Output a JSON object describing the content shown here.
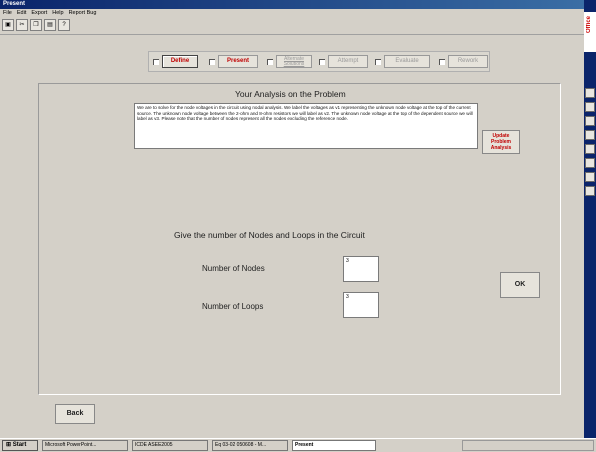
{
  "window": {
    "title": "Present"
  },
  "menu": [
    "File",
    "Edit",
    "Export",
    "Help",
    "Report Bug"
  ],
  "toolbar": [
    {
      "name": "save-icon",
      "glyph": "▣"
    },
    {
      "name": "cut-icon",
      "glyph": "✂"
    },
    {
      "name": "copy-icon",
      "glyph": "❐"
    },
    {
      "name": "paste-icon",
      "glyph": "▤"
    },
    {
      "name": "help-icon",
      "glyph": "?"
    }
  ],
  "steps": [
    {
      "label": "Define",
      "checked": true,
      "enabled": true
    },
    {
      "label": "Present",
      "checked": false,
      "enabled": true
    },
    {
      "label": "Alternate Solutions",
      "checked": false,
      "enabled": false
    },
    {
      "label": "Attempt",
      "checked": false,
      "enabled": false
    },
    {
      "label": "Evaluate",
      "checked": false,
      "enabled": false
    },
    {
      "label": "Rework",
      "checked": false,
      "enabled": false
    }
  ],
  "analysis": {
    "title": "Your Analysis on the Problem",
    "text": "We are to solve for the node voltages in the circuit using nodal analysis.  We label the voltages as v1 representing the unknown node voltage at the top of the current source.  The unknown node voltage between the 2-ohm and 8-ohm resistors we will label as v2.  The unknown node voltage at the top of the dependent source we will label as v3.  Please note that the number of nodes represent all the nodes excluding the reference node.",
    "update_label": "Update Problem Analysis"
  },
  "question": "Give the number of Nodes and Loops in the Circuit",
  "fields": {
    "nodes_label": "Number of Nodes",
    "nodes_value": "3",
    "loops_label": "Number of Loops",
    "loops_value": "3"
  },
  "buttons": {
    "ok": "OK",
    "back": "Back"
  },
  "sidebar": {
    "office_label": "Office"
  },
  "taskbar": {
    "start": "Start",
    "tasks": [
      {
        "label": "Microsoft PowerPoint...",
        "active": false
      },
      {
        "label": "ICDE ASEE2005",
        "active": false
      },
      {
        "label": "Eq 03-02 050608 - M...",
        "active": false
      },
      {
        "label": "Present",
        "active": true
      }
    ]
  }
}
